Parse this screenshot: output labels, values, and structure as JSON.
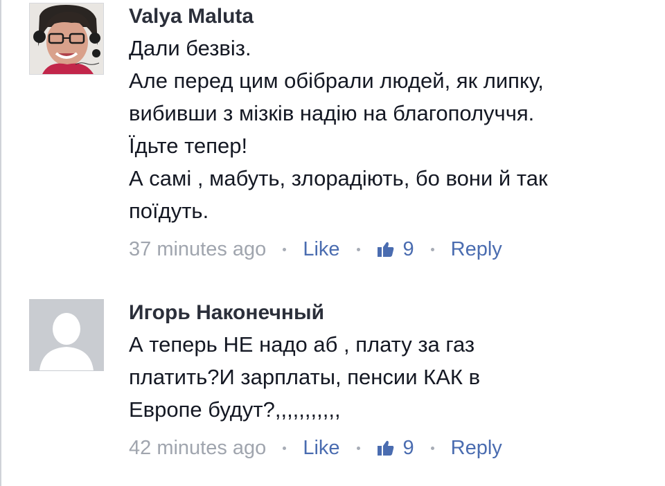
{
  "comments": [
    {
      "author": "Valya Maluta",
      "lines": [
        "Дали безвіз.",
        "Але перед цим обібрали людей, як липку,",
        "вибивши з мізків надію на благополуччя.",
        "Їдьте тепер!",
        "А самі , мабуть, злорадіють, бо вони й так",
        "поїдуть."
      ],
      "time": "37 minutes ago",
      "like_label": "Like",
      "like_count": "9",
      "reply_label": "Reply",
      "avatar_icon": "user-photo-icon"
    },
    {
      "author": "Игорь Наконечный",
      "lines": [
        "А теперь НЕ надо аб , плату за газ",
        "платить?И зарплаты, пенсии КАК  в",
        "Европе будут?,,,,,,,,,,,"
      ],
      "time": "42 minutes ago",
      "like_label": "Like",
      "like_count": "9",
      "reply_label": "Reply",
      "avatar_icon": "default-avatar-icon"
    }
  ],
  "colors": {
    "link": "#4a6cb0",
    "meta": "#9197a3",
    "text": "#141823"
  }
}
